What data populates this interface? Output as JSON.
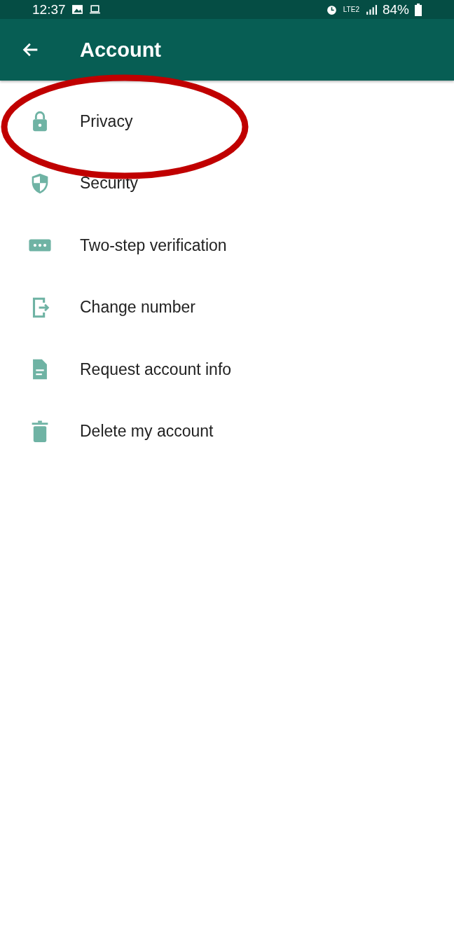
{
  "status_bar": {
    "time": "12:37",
    "battery": "84%",
    "network": "LTE2"
  },
  "header": {
    "title": "Account"
  },
  "items": [
    {
      "label": "Privacy",
      "kind": "lock",
      "highlighted": true
    },
    {
      "label": "Security",
      "kind": "shield",
      "highlighted": false
    },
    {
      "label": "Two-step verification",
      "kind": "dots",
      "highlighted": false
    },
    {
      "label": "Change number",
      "kind": "exit",
      "highlighted": false
    },
    {
      "label": "Request account info",
      "kind": "document",
      "highlighted": false
    },
    {
      "label": "Delete my account",
      "kind": "trash",
      "highlighted": false
    }
  ]
}
